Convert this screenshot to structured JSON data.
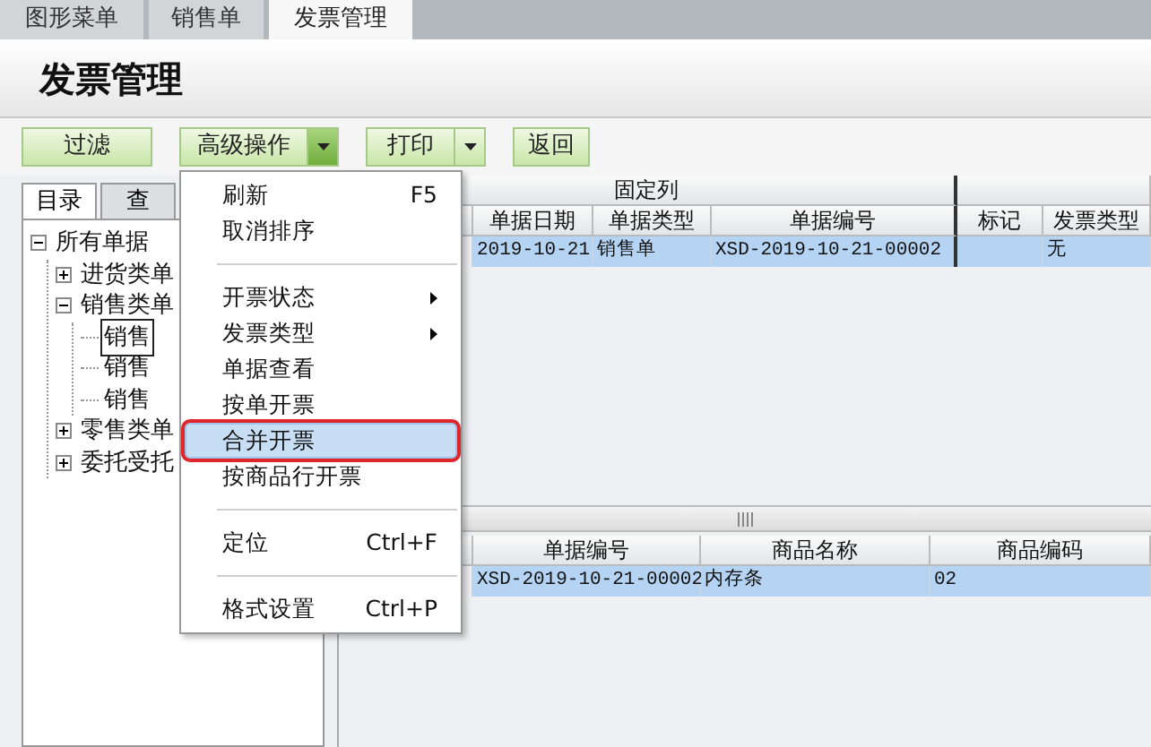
{
  "tabs": [
    {
      "label": "图形菜单",
      "selected": false
    },
    {
      "label": "销售单",
      "selected": false
    },
    {
      "label": "发票管理",
      "selected": true
    }
  ],
  "page_title": "发票管理",
  "toolbar": [
    {
      "label": "过滤",
      "kind": "plain"
    },
    {
      "label": "高级操作",
      "kind": "split",
      "dropdown_open": true
    },
    {
      "label": "打印",
      "kind": "split",
      "dropdown_open": false
    },
    {
      "label": "返回",
      "kind": "plain"
    }
  ],
  "left_tabs": [
    {
      "label": "目录",
      "selected": true
    },
    {
      "label": "查",
      "selected": false
    }
  ],
  "tree": [
    {
      "label": "所有单据",
      "expanded": true,
      "selected": false,
      "children": [
        {
          "label": "进货类单",
          "expanded": false,
          "selected": false
        },
        {
          "label": "销售类单",
          "expanded": true,
          "selected": false,
          "children": [
            {
              "label": "销售",
              "selected": true
            },
            {
              "label": "销售",
              "selected": false
            },
            {
              "label": "销售",
              "selected": false
            }
          ]
        },
        {
          "label": "零售类单",
          "expanded": false,
          "selected": false
        },
        {
          "label": "委托受托",
          "expanded": false,
          "selected": false
        }
      ]
    }
  ],
  "main_grid": {
    "group_header": "固定列",
    "columns": [
      "单据日期",
      "单据类型",
      "单据编号",
      "标记",
      "发票类型"
    ],
    "rows": [
      {
        "date": "2019-10-21",
        "type": "销售单",
        "number": "XSD-2019-10-21-00002",
        "invoice_type": "无",
        "selected": true
      }
    ]
  },
  "detail_grid": {
    "columns": [
      "单据编号",
      "商品名称",
      "商品编码"
    ],
    "rows": [
      {
        "cells": [
          "XSD-2019-10-21-00002",
          "内存条",
          "02"
        ],
        "selected": true
      }
    ]
  },
  "context_menu": {
    "items": [
      {
        "kind": "item",
        "label": "刷新",
        "shortcut": "F5",
        "selected": false,
        "annotated": false
      },
      {
        "kind": "item",
        "label": "取消排序",
        "selected": false,
        "annotated": false
      },
      {
        "kind": "separator"
      },
      {
        "kind": "submenu",
        "label": "开票状态",
        "selected": false,
        "annotated": false
      },
      {
        "kind": "submenu",
        "label": "发票类型",
        "selected": false,
        "annotated": false
      },
      {
        "kind": "item",
        "label": "单据查看",
        "selected": false,
        "annotated": false
      },
      {
        "kind": "item",
        "label": "按单开票",
        "selected": false,
        "annotated": false
      },
      {
        "kind": "item",
        "label": "合并开票",
        "selected": true,
        "annotated": true
      },
      {
        "kind": "item",
        "label": "按商品行开票",
        "selected": false,
        "annotated": false
      },
      {
        "kind": "separator"
      },
      {
        "kind": "item",
        "label": "定位",
        "shortcut": "Ctrl+F",
        "selected": false,
        "annotated": false
      },
      {
        "kind": "separator"
      },
      {
        "kind": "item",
        "label": "格式设置",
        "shortcut": "Ctrl+P",
        "selected": false,
        "annotated": false
      }
    ]
  }
}
